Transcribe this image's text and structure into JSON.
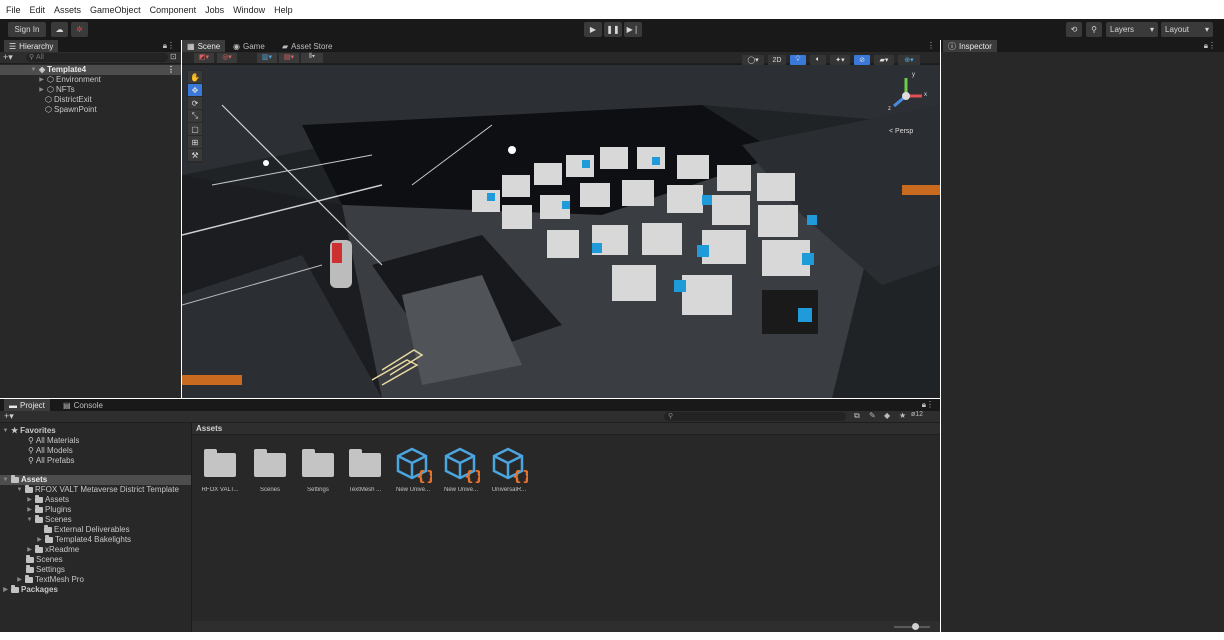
{
  "menu": [
    "File",
    "Edit",
    "Assets",
    "GameObject",
    "Component",
    "Jobs",
    "Window",
    "Help"
  ],
  "toolbar": {
    "sign_in": "Sign In",
    "cloud_icon": "cloud-icon",
    "collab_icon": "collab-icon",
    "play_icon": "play-icon",
    "pause_icon": "pause-icon",
    "step_icon": "step-icon",
    "history_icon": "history-icon",
    "search_icon": "search-icon",
    "layers": "Layers",
    "layout": "Layout"
  },
  "hierarchy": {
    "tab": "Hierarchy",
    "search_placeholder": "All",
    "root": "Template4",
    "children": [
      "Environment",
      "NFTs",
      "DistrictExit",
      "SpawnPoint"
    ]
  },
  "scene": {
    "tabs": [
      "Scene",
      "Game",
      "Asset Store"
    ],
    "mode_2d": "2D",
    "persp": "< Persp",
    "axis_y": "y",
    "axis_x": "x",
    "axis_z": "z"
  },
  "inspector": {
    "tab": "Inspector"
  },
  "project": {
    "tabs": [
      "Project",
      "Console"
    ],
    "hidden_count": "12",
    "favorites": {
      "label": "Favorites",
      "items": [
        "All Materials",
        "All Models",
        "All Prefabs"
      ]
    },
    "assets_tree": {
      "root": "Assets",
      "district": "RFOX VALT Metaverse District Template",
      "assets": "Assets",
      "plugins": "Plugins",
      "scenes": "Scenes",
      "external": "External Deliverables",
      "bakelights": "Template4 Bakelights",
      "readme": "xReadme",
      "scenes2": "Scenes",
      "settings": "Settings",
      "textmesh": "TextMesh Pro",
      "packages": "Packages"
    },
    "breadcrumb": "Assets",
    "items": [
      {
        "label": "RFOX VALT...",
        "type": "folder"
      },
      {
        "label": "Scenes",
        "type": "folder"
      },
      {
        "label": "Settings",
        "type": "folder"
      },
      {
        "label": "TextMesh ...",
        "type": "folder"
      },
      {
        "label": "New Unive...",
        "type": "package"
      },
      {
        "label": "New Unive...",
        "type": "package"
      },
      {
        "label": "UniversalR...",
        "type": "package"
      }
    ]
  },
  "colors": {
    "accent": "#3a79d8",
    "selected_row": "#4d4d4d",
    "package_blue": "#4aa5e0",
    "package_orange": "#e8732e"
  }
}
